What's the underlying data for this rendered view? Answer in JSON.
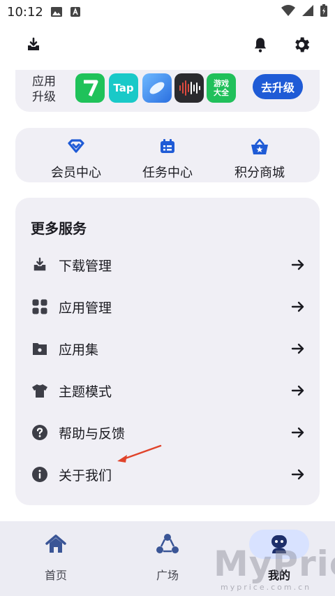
{
  "status_bar": {
    "time": "10:12"
  },
  "upgrade": {
    "label": "应用升级",
    "apps": [
      {
        "name": "app-1",
        "text": "7",
        "color": "#1fc25a"
      },
      {
        "name": "app-2",
        "text": "Tap",
        "color": "#19c9c8"
      },
      {
        "name": "app-3",
        "text": "",
        "color": "#3a8df0"
      },
      {
        "name": "app-4",
        "text": "",
        "color": "#2a2a2e"
      },
      {
        "name": "app-5",
        "text": "游戏大全",
        "color": "#21c05b"
      }
    ],
    "button_label": "去升级"
  },
  "quick": [
    {
      "label": "会员中心"
    },
    {
      "label": "任务中心"
    },
    {
      "label": "积分商城"
    }
  ],
  "services": {
    "title": "更多服务",
    "items": [
      {
        "label": "下载管理"
      },
      {
        "label": "应用管理"
      },
      {
        "label": "应用集"
      },
      {
        "label": "主题模式"
      },
      {
        "label": "帮助与反馈"
      },
      {
        "label": "关于我们"
      }
    ]
  },
  "nav": [
    {
      "label": "首页"
    },
    {
      "label": "广场"
    },
    {
      "label": "我的"
    }
  ],
  "watermark": {
    "big": "MyPrice",
    "small": "myprice.com.cn"
  },
  "colors": {
    "accent": "#1f5bd6",
    "icon": "#3d3e47",
    "arrow_annotation": "#e0432a"
  }
}
